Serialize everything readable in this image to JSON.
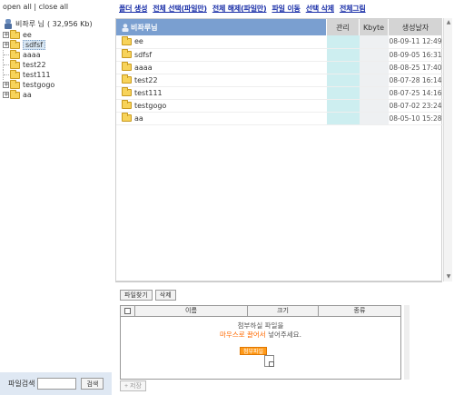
{
  "sidebar": {
    "open_all": "open all",
    "separator": " | ",
    "close_all": "close all",
    "root_name": "비좌루 님",
    "root_size": "( 32,956 Kb)",
    "tree": [
      {
        "label": "ee",
        "toggle": "+"
      },
      {
        "label": "sdfsf",
        "toggle": "+",
        "selected": true
      },
      {
        "label": "aaaa",
        "toggle": ""
      },
      {
        "label": "test22",
        "toggle": ""
      },
      {
        "label": "test111",
        "toggle": ""
      },
      {
        "label": "testgogo",
        "toggle": "+"
      },
      {
        "label": "aa",
        "toggle": "+"
      }
    ],
    "search": {
      "label": "파일검색",
      "button": "검색",
      "value": ""
    }
  },
  "topmenu": [
    "폴더 생성",
    "전체 선택(파일만)",
    "전체 해제(파일만)",
    "파일 이동",
    "선택 삭제",
    "전체그림"
  ],
  "filelist": {
    "header": {
      "name": "비좌루님",
      "mgmt": "관리",
      "size": "Kbyte",
      "date": "생성날자"
    },
    "rows": [
      {
        "name": "ee",
        "date": "08-09-11 12:49"
      },
      {
        "name": "sdfsf",
        "date": "08-09-05 16:31"
      },
      {
        "name": "aaaa",
        "date": "08-08-25 17:40"
      },
      {
        "name": "test22",
        "date": "08-07-28 16:14"
      },
      {
        "name": "test111",
        "date": "08-07-25 14:16"
      },
      {
        "name": "testgogo",
        "date": "08-07-02 23:24"
      },
      {
        "name": "aa",
        "date": "08-05-10 15:28"
      }
    ]
  },
  "upload": {
    "find_button": "파일찾기",
    "delete_button": "삭제",
    "columns": {
      "name": "이름",
      "size": "크기",
      "type": "종류"
    },
    "msg_line1": "첨부하실 파일을",
    "msg_line2_highlight": "마우스로 끌어서",
    "msg_line2_rest": " 넣어주세요.",
    "badge": "첨부파일",
    "save_button": "+ 저장"
  },
  "colors": {
    "header_blue": "#7a9fd0",
    "mgmt_cyan": "#cdeef0",
    "link_blue": "#1a2fa8",
    "highlight_orange": "#ff6a00"
  }
}
